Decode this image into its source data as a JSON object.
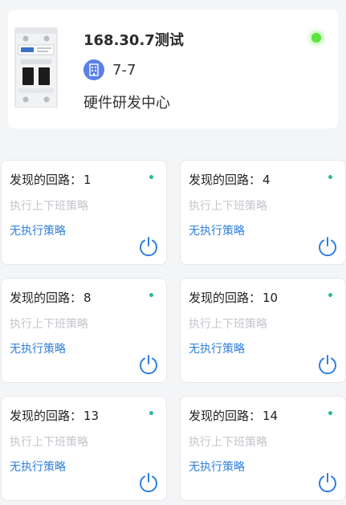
{
  "device": {
    "name": "168.30.7测试",
    "location": "7-7",
    "organization": "硬件研发中心",
    "status_color": "#57e53e"
  },
  "circuits": [
    {
      "label": "发现的回路：",
      "number": "1",
      "schedule": "执行上下班策略",
      "policy": "无执行策略"
    },
    {
      "label": "发现的回路：",
      "number": "4",
      "schedule": "执行上下班策略",
      "policy": "无执行策略"
    },
    {
      "label": "发现的回路：",
      "number": "8",
      "schedule": "执行上下班策略",
      "policy": "无执行策略"
    },
    {
      "label": "发现的回路：",
      "number": "10",
      "schedule": "执行上下班策略",
      "policy": "无执行策略"
    },
    {
      "label": "发现的回路：",
      "number": "13",
      "schedule": "执行上下班策略",
      "policy": "无执行策略"
    },
    {
      "label": "发现的回路：",
      "number": "14",
      "schedule": "执行上下班策略",
      "policy": "无执行策略"
    }
  ],
  "colors": {
    "accent": "#2f7fdc",
    "online_dot": "#29b89a",
    "location_icon_bg": "#5a80e8"
  },
  "icons": {
    "device": "circuit-breaker-icon",
    "location": "building-icon",
    "power": "power-icon"
  }
}
